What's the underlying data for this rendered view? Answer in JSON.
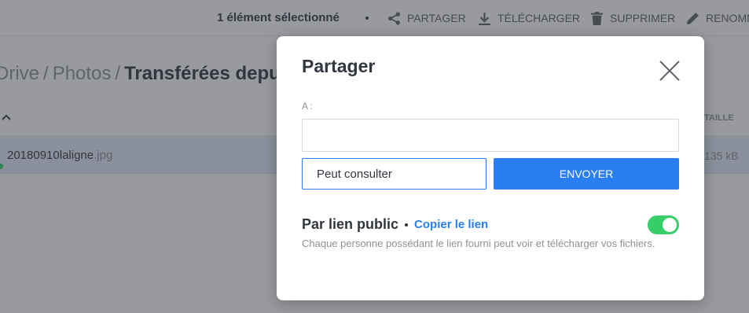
{
  "topbar": {
    "selection_text": "1 élément sélectionné",
    "actions": [
      {
        "label": "PARTAGER",
        "icon": "share-icon"
      },
      {
        "label": "TÉLÉCHARGER",
        "icon": "download-icon"
      },
      {
        "label": "SUPPRIMER",
        "icon": "trash-icon"
      },
      {
        "label": "RENOMMER",
        "icon": "pencil-icon"
      }
    ]
  },
  "breadcrumb": {
    "items": [
      "Drive",
      "Photos"
    ],
    "current": "Transférées depuis Cozy"
  },
  "table": {
    "size_header": "TAILLE",
    "rows": [
      {
        "name": "20180910laligne",
        "ext": ".jpg",
        "size": "135 kB"
      }
    ]
  },
  "modal": {
    "title": "Partager",
    "to_label": "A :",
    "to_value": "",
    "permission": "Peut consulter",
    "send_label": "ENVOYER",
    "public_title": "Par lien public",
    "copy_link_label": "Copier le lien",
    "public_description": "Chaque personne possédant le lien fourni peut voir et télécharger vos fichiers.",
    "public_link_enabled": true
  },
  "colors": {
    "primary": "#297ef2",
    "toggle_on": "#35ce68",
    "overlay": "rgba(50,54,63,0.5)"
  }
}
